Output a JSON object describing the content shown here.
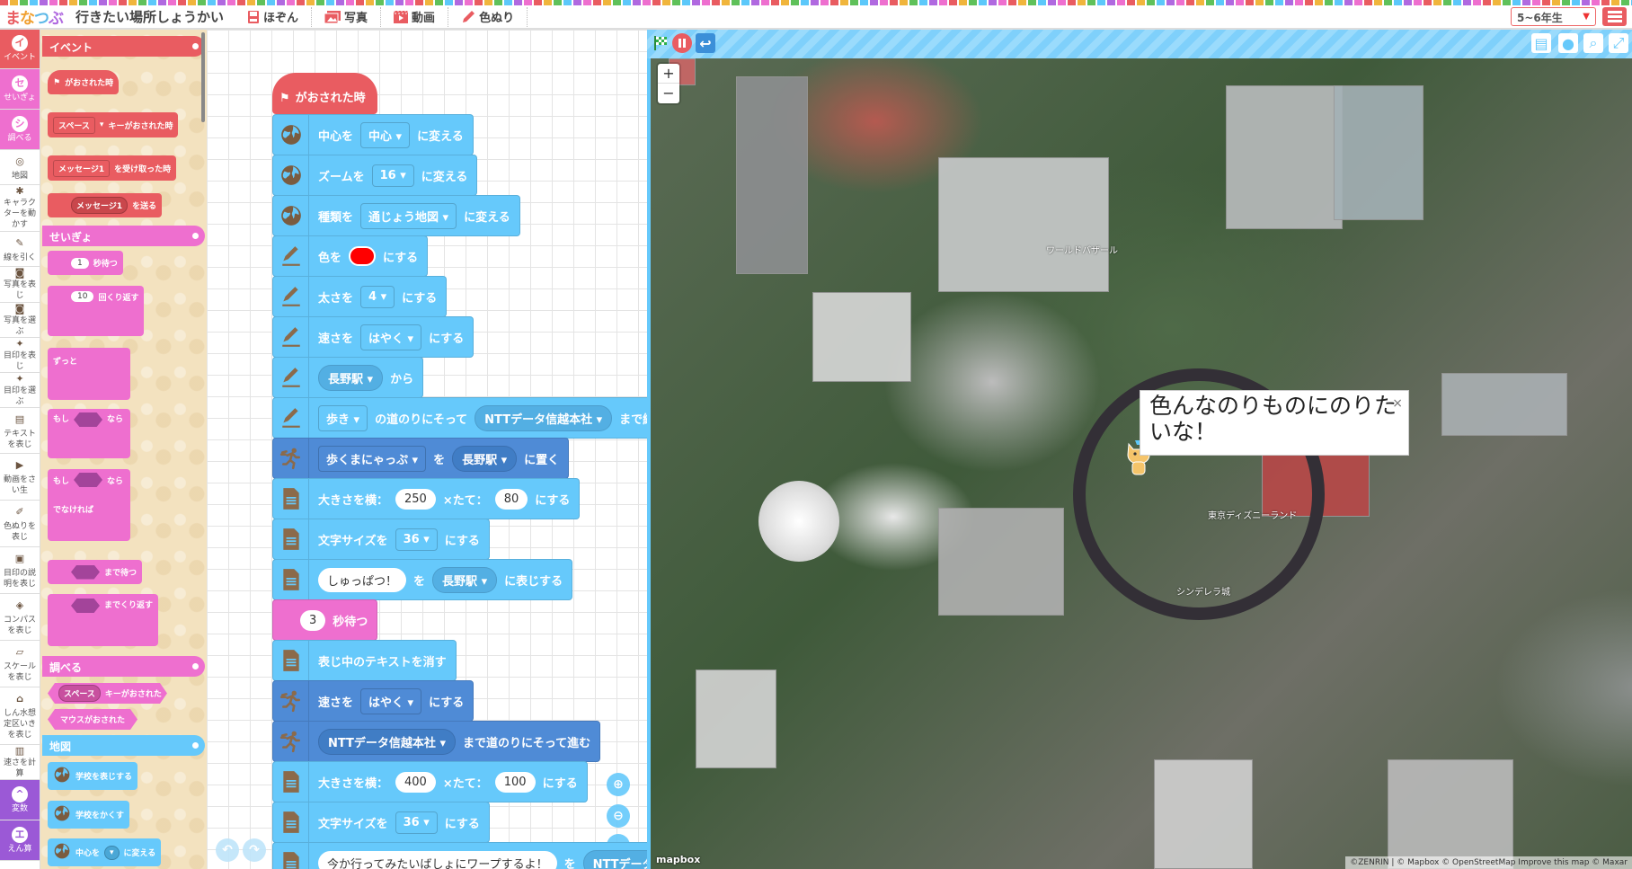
{
  "header": {
    "logo": [
      "ま",
      "な",
      "つ",
      "ぶ"
    ],
    "logo_text": "まなつぶ",
    "title": "行きたい場所しょうかい",
    "buttons": [
      {
        "label": "ほぞん",
        "icon": "save-icon"
      },
      {
        "label": "写真",
        "icon": "photo-icon"
      },
      {
        "label": "動画",
        "icon": "video-icon"
      },
      {
        "label": "色ぬり",
        "icon": "pencil-icon"
      }
    ],
    "grade": "5~6年生"
  },
  "categories": [
    {
      "label": "イベント",
      "glyph": "イ",
      "color": "#e95c61",
      "selected": true
    },
    {
      "label": "せいぎょ",
      "glyph": "セ",
      "color": "#ee6fcf",
      "selected": true
    },
    {
      "label": "調べる",
      "glyph": "シ",
      "color": "#ee6fcf",
      "selected": true
    },
    {
      "label": "地図",
      "glyph": "◎"
    },
    {
      "label": "キャラクターを動かす",
      "glyph": "✱"
    },
    {
      "label": "線を引く",
      "glyph": "✎"
    },
    {
      "label": "写真を表じ",
      "glyph": "◙"
    },
    {
      "label": "写真を選ぶ",
      "glyph": "◙"
    },
    {
      "label": "目印を表じ",
      "glyph": "✦"
    },
    {
      "label": "目印を選ぶ",
      "glyph": "✦"
    },
    {
      "label": "テキストを表じ",
      "glyph": "▤"
    },
    {
      "label": "動画をさい生",
      "glyph": "▶"
    },
    {
      "label": "色ぬりを表じ",
      "glyph": "✐"
    },
    {
      "label": "目印の説明を表じ",
      "glyph": "▣"
    },
    {
      "label": "コンパスを表じ",
      "glyph": "◈"
    },
    {
      "label": "スケールを表じ",
      "glyph": "▱"
    },
    {
      "label": "しん水想定区いきを表じ",
      "glyph": "⌂"
    },
    {
      "label": "速さを計算",
      "glyph": "▥"
    },
    {
      "label": "変数",
      "glyph": "^",
      "color": "#9b59d6",
      "selected": true
    },
    {
      "label": "えん算",
      "glyph": "エ",
      "color": "#9b59d6",
      "selected": true
    }
  ],
  "palette": {
    "headers": {
      "event": "イベント",
      "control": "せいぎょ",
      "sensing": "調べる",
      "map": "地図"
    },
    "flag_clicked": "がおされた時",
    "key_pressed": {
      "key": "スペース",
      "text": "キーがおされた時"
    },
    "receive": {
      "msg": "メッセージ1",
      "text": "を受け取った時"
    },
    "send": {
      "msg": "メッセージ1",
      "text": "を送る"
    },
    "wait": {
      "value": "1",
      "text": "秒待つ"
    },
    "repeat": {
      "value": "10",
      "text": "回くり返す"
    },
    "forever": "ずっと",
    "if": {
      "a": "もし",
      "b": "なら"
    },
    "ifelse": {
      "a": "もし",
      "b": "なら",
      "else": "でなければ"
    },
    "wait_until": "まで待つ",
    "repeat_until": "までくり返す",
    "key_sensing": {
      "key": "スペース",
      "text": "キーがおされた"
    },
    "mouse": "マウスがおされた",
    "show_school": "学校を表じする",
    "hide_school": "学校をかくす",
    "center": {
      "a": "中心を",
      "b": "に変える"
    }
  },
  "script": {
    "hat": "がおされた時",
    "blocks": [
      {
        "kind": "blue",
        "icon": "globe",
        "parts": [
          {
            "t": "text",
            "v": "中心を"
          },
          {
            "t": "dd",
            "v": "中心"
          },
          {
            "t": "text",
            "v": "に変える"
          }
        ]
      },
      {
        "kind": "blue",
        "icon": "globe",
        "parts": [
          {
            "t": "text",
            "v": "ズームを"
          },
          {
            "t": "dd",
            "v": "16"
          },
          {
            "t": "text",
            "v": "に変える"
          }
        ]
      },
      {
        "kind": "blue",
        "icon": "globe",
        "parts": [
          {
            "t": "text",
            "v": "種類を"
          },
          {
            "t": "dd",
            "v": "通じょう地図"
          },
          {
            "t": "text",
            "v": "に変える"
          }
        ]
      },
      {
        "kind": "blue",
        "icon": "pencil",
        "parts": [
          {
            "t": "text",
            "v": "色を"
          },
          {
            "t": "color",
            "v": "#ff0000"
          },
          {
            "t": "text",
            "v": "にする"
          }
        ]
      },
      {
        "kind": "blue",
        "icon": "pencil",
        "parts": [
          {
            "t": "text",
            "v": "太さを"
          },
          {
            "t": "dd",
            "v": "4"
          },
          {
            "t": "text",
            "v": "にする"
          }
        ]
      },
      {
        "kind": "blue",
        "icon": "pencil",
        "parts": [
          {
            "t": "text",
            "v": "速さを"
          },
          {
            "t": "dd",
            "v": "はやく"
          },
          {
            "t": "text",
            "v": "にする"
          }
        ]
      },
      {
        "kind": "blue",
        "icon": "pencil",
        "parts": [
          {
            "t": "rdd",
            "v": "長野駅"
          },
          {
            "t": "text",
            "v": "から"
          }
        ]
      },
      {
        "kind": "blue",
        "icon": "pencil",
        "parts": [
          {
            "t": "dd",
            "v": "歩き"
          },
          {
            "t": "text",
            "v": "の道のりにそって"
          },
          {
            "t": "rdd",
            "v": "NTTデータ信越本社"
          },
          {
            "t": "text",
            "v": "まで線を引く"
          }
        ]
      },
      {
        "kind": "dark",
        "icon": "runner",
        "parts": [
          {
            "t": "dd",
            "v": "歩くまにゃっぷ"
          },
          {
            "t": "text",
            "v": "を"
          },
          {
            "t": "rdd",
            "v": "長野駅"
          },
          {
            "t": "text",
            "v": "に置く"
          }
        ]
      },
      {
        "kind": "blue",
        "icon": "doc",
        "parts": [
          {
            "t": "text",
            "v": "大きさを横："
          },
          {
            "t": "oval",
            "v": "250"
          },
          {
            "t": "text",
            "v": "×たて："
          },
          {
            "t": "oval",
            "v": "80"
          },
          {
            "t": "text",
            "v": "にする"
          }
        ]
      },
      {
        "kind": "blue",
        "icon": "doc",
        "parts": [
          {
            "t": "text",
            "v": "文字サイズを"
          },
          {
            "t": "dd",
            "v": "36"
          },
          {
            "t": "text",
            "v": "にする"
          }
        ]
      },
      {
        "kind": "blue",
        "icon": "doc",
        "parts": [
          {
            "t": "oval",
            "v": "しゅっぱつ！"
          },
          {
            "t": "text",
            "v": "を"
          },
          {
            "t": "rdd",
            "v": "長野駅"
          },
          {
            "t": "text",
            "v": "に表じする"
          }
        ]
      },
      {
        "kind": "pink",
        "icon": "",
        "parts": [
          {
            "t": "oval",
            "v": "3"
          },
          {
            "t": "text",
            "v": "秒待つ"
          }
        ]
      },
      {
        "kind": "blue",
        "icon": "doc",
        "parts": [
          {
            "t": "text",
            "v": "表じ中のテキストを消す"
          }
        ]
      },
      {
        "kind": "dark",
        "icon": "runner",
        "parts": [
          {
            "t": "text",
            "v": "速さを"
          },
          {
            "t": "dd",
            "v": "はやく"
          },
          {
            "t": "text",
            "v": "にする"
          }
        ]
      },
      {
        "kind": "dark",
        "icon": "runner",
        "parts": [
          {
            "t": "rdd",
            "v": "NTTデータ信越本社"
          },
          {
            "t": "text",
            "v": "まで道のりにそって進む"
          }
        ]
      },
      {
        "kind": "blue",
        "icon": "doc",
        "parts": [
          {
            "t": "text",
            "v": "大きさを横："
          },
          {
            "t": "oval",
            "v": "400"
          },
          {
            "t": "text",
            "v": "×たて："
          },
          {
            "t": "oval",
            "v": "100"
          },
          {
            "t": "text",
            "v": "にする"
          }
        ]
      },
      {
        "kind": "blue",
        "icon": "doc",
        "parts": [
          {
            "t": "text",
            "v": "文字サイズを"
          },
          {
            "t": "dd",
            "v": "36"
          },
          {
            "t": "text",
            "v": "にする"
          }
        ]
      },
      {
        "kind": "blue",
        "icon": "doc",
        "parts": [
          {
            "t": "oval",
            "v": "今か行ってみたいばしょにワープするよ！"
          },
          {
            "t": "text",
            "v": "を"
          },
          {
            "t": "rdd",
            "v": "NTTデータ信越本社"
          }
        ]
      }
    ]
  },
  "map": {
    "zoom_in": "+",
    "zoom_out": "−",
    "popup_text": "色んなのりものにのりたいな！",
    "popup_close": "×",
    "labels": [
      "ワールドバザール",
      "東京ディズニーランド",
      "シンデレラ城"
    ],
    "logo": "mapbox",
    "attribution": "©ZENRIN | © Mapbox © OpenStreetMap  Improve this map © Maxar"
  },
  "colors": {
    "event": "#e95c61",
    "control": "#ee6fcf",
    "map": "#66c9fb",
    "character": "#4f8bd6",
    "variables": "#9b59d6"
  }
}
